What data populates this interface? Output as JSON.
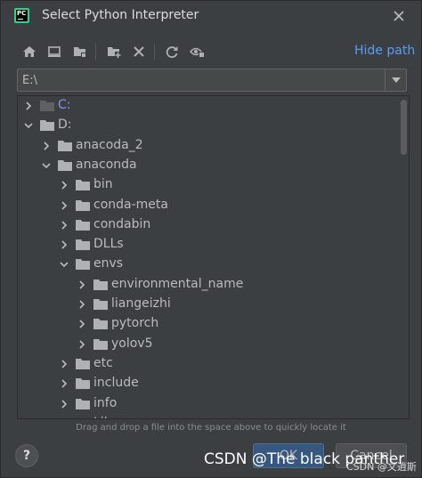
{
  "window": {
    "title": "Select Python Interpreter",
    "app_icon_text": "PC"
  },
  "toolbar": {
    "buttons": [
      "home-icon",
      "desktop-icon",
      "project-folder-icon",
      "new-folder-icon",
      "delete-icon",
      "refresh-icon",
      "show-hidden-icon"
    ],
    "hide_path_label": "Hide path"
  },
  "path_field": {
    "value": "E:\\"
  },
  "tree": {
    "rows": [
      {
        "label": "C:",
        "expanded": false
      },
      {
        "label": "D:",
        "expanded": true
      },
      {
        "label": "anacoda_2",
        "expanded": false
      },
      {
        "label": "anaconda",
        "expanded": true
      },
      {
        "label": "bin",
        "expanded": false
      },
      {
        "label": "conda-meta",
        "expanded": false
      },
      {
        "label": "condabin",
        "expanded": false
      },
      {
        "label": "DLLs",
        "expanded": false
      },
      {
        "label": "envs",
        "expanded": true
      },
      {
        "label": "environmental_name",
        "expanded": false
      },
      {
        "label": "liangeizhi",
        "expanded": false
      },
      {
        "label": "pytorch",
        "expanded": false
      },
      {
        "label": "yolov5",
        "expanded": false
      },
      {
        "label": "etc",
        "expanded": false
      },
      {
        "label": "include",
        "expanded": false
      },
      {
        "label": "info",
        "expanded": false
      },
      {
        "label": "Lib",
        "expanded": false
      }
    ]
  },
  "hint": "Drag and drop a file into the space above to quickly locate it",
  "footer": {
    "help_label": "?",
    "ok_label": "OK",
    "cancel_label": "Cancel"
  },
  "watermark": {
    "main": "CSDN @The black panther",
    "secondary": "CSDN @文逍斯"
  },
  "colors": {
    "background": "#3c3f41",
    "link": "#589df6",
    "folder": "#afb1b3",
    "ok_button": "#365880"
  }
}
